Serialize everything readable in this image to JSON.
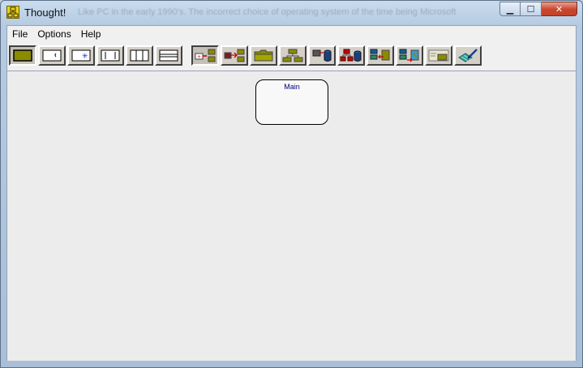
{
  "window": {
    "title": "Thought!",
    "title_ghost": "Like PC in the early 1990's. The incorrect choice of operating system of the time being Microsoft",
    "controls": {
      "minimize": "▁",
      "maximize": "☐",
      "close": "✕"
    }
  },
  "menu": {
    "file": "File",
    "options": "Options",
    "help": "Help"
  },
  "toolbar": {
    "tools": [
      {
        "name": "box-outline-tool-icon"
      },
      {
        "name": "box-corner-tool-icon"
      },
      {
        "name": "box-star-tool-icon"
      },
      {
        "name": "box-brackets-tool-icon"
      },
      {
        "name": "box-bars-tool-icon"
      },
      {
        "name": "box-lines-tool-icon"
      },
      {
        "name": "add-child-node-icon"
      },
      {
        "name": "add-sibling-node-icon"
      },
      {
        "name": "folder-node-icon"
      },
      {
        "name": "tree-layout-icon"
      },
      {
        "name": "database-link-icon"
      },
      {
        "name": "network-database-icon"
      },
      {
        "name": "import-nodes-icon"
      },
      {
        "name": "export-nodes-icon"
      },
      {
        "name": "note-node-icon"
      },
      {
        "name": "pen-edit-icon"
      }
    ]
  },
  "canvas": {
    "nodes": [
      {
        "label": "Main"
      }
    ]
  },
  "colors": {
    "olive": "#8b8b00",
    "tool_face": "#d4d0c8",
    "canvas": "#ececec",
    "node_text": "#000080"
  }
}
